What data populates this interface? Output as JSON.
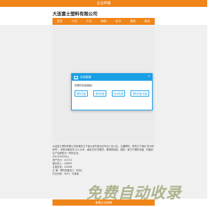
{
  "top_bar": {
    "title": "企业商铺"
  },
  "company": {
    "name": "大连富士塑料有限公司"
  },
  "nav": [
    "首页",
    "介绍",
    "产品",
    "商情",
    "证书",
    "案例",
    "联系"
  ],
  "modal": {
    "title": "在线客服",
    "close": "×",
    "prompt": "您是在找如图品：",
    "buttons": [
      "塑料托盘",
      "塑料托盘",
      "标示托盘",
      "塑料托盘 托盘"
    ]
  },
  "info": {
    "lines": [
      "大连富士塑料有限公司坐落在辽宁省大连市金州区华北工业川区，交通便利，是本辽宁省区“苏州科研号”，本着长期合作“以人为本，诚信为先”的理念，秉承着诚信、服务，致力于塑料托盘、托盘的生产及销售为一体的企业。",
      "0411-87620111。",
      "资产总计：214712",
      "营业收入：236879",
      "主营业务：220328",
      "主 营：塑料托盘加工（代加）",
      "行业代码：9070、与其他"
    ]
  },
  "cta": {
    "label": "查看企业商铺"
  },
  "watermark": {
    "text": "免费自动收录"
  }
}
